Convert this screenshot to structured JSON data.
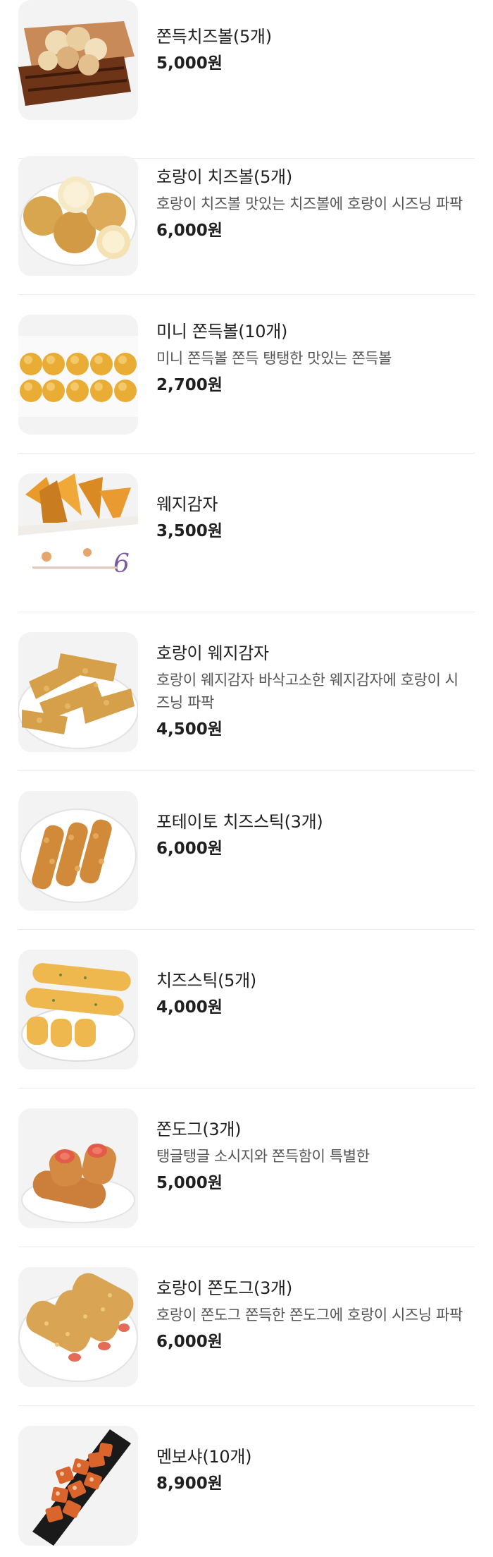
{
  "menu": {
    "items": [
      {
        "name": "쫀득치즈볼(5개)",
        "description": "",
        "price": "5,000원",
        "image_icon": "cheese-ball-basket-image"
      },
      {
        "name": "호랑이 치즈볼(5개)",
        "description": "호랑이 치즈볼 맛있는 치즈볼에 호랑이 시즈닝 파팍",
        "price": "6,000원",
        "image_icon": "tiger-cheese-ball-image"
      },
      {
        "name": "미니 쫀득볼(10개)",
        "description": "미니 쫀득볼 쫀득 탱탱한 맛있는 쫀득볼",
        "price": "2,700원",
        "image_icon": "mini-chewy-ball-image"
      },
      {
        "name": "웨지감자",
        "description": "",
        "price": "3,500원",
        "image_icon": "wedge-potato-box-image"
      },
      {
        "name": "호랑이 웨지감자",
        "description": "호랑이 웨지감자 바삭고소한 웨지감자에 호랑이 시즈닝 파팍",
        "price": "4,500원",
        "image_icon": "tiger-wedge-potato-image"
      },
      {
        "name": "포테이토 치즈스틱(3개)",
        "description": "",
        "price": "6,000원",
        "image_icon": "potato-cheese-stick-image"
      },
      {
        "name": "치즈스틱(5개)",
        "description": "",
        "price": "4,000원",
        "image_icon": "cheese-stick-image"
      },
      {
        "name": "쫀도그(3개)",
        "description": "탱글탱글 소시지와 쫀득함이 특별한",
        "price": "5,000원",
        "image_icon": "corn-dog-image"
      },
      {
        "name": "호랑이 쫀도그(3개)",
        "description": "호랑이 쫀도그 쫀득한 쫀도그에 호랑이 시즈닝 파팍",
        "price": "6,000원",
        "image_icon": "tiger-corn-dog-image"
      },
      {
        "name": "멘보샤(10개)",
        "description": "",
        "price": "8,900원",
        "image_icon": "menbosha-image"
      }
    ]
  }
}
